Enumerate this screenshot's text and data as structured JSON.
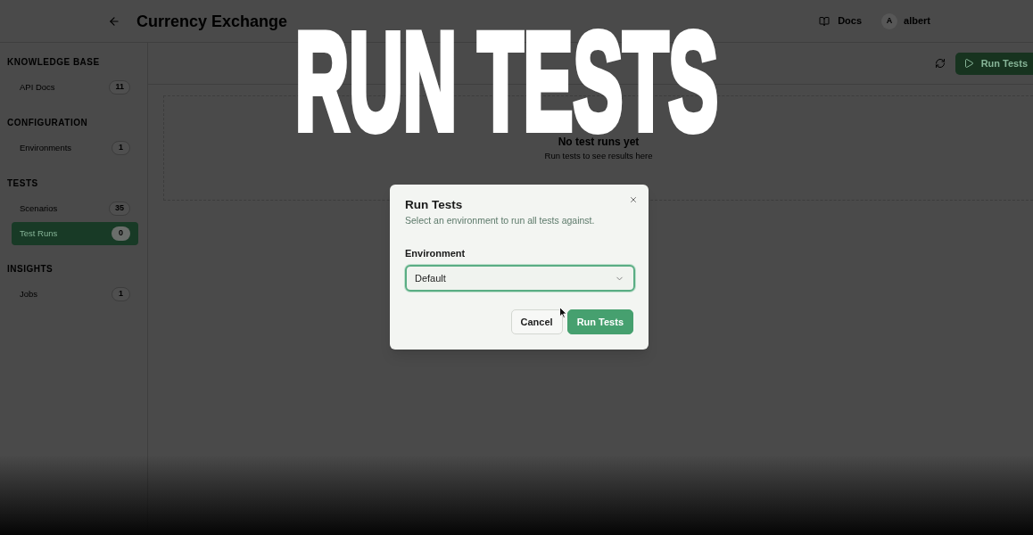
{
  "header": {
    "title": "Currency Exchange",
    "docs_link": "Docs",
    "user": {
      "initial": "A",
      "name": "albert"
    }
  },
  "sidebar": {
    "sections": [
      {
        "title": "KNOWLEDGE BASE",
        "items": [
          {
            "label": "API Docs",
            "count": "11",
            "selected": false
          }
        ]
      },
      {
        "title": "CONFIGURATION",
        "items": [
          {
            "label": "Environments",
            "count": "1",
            "selected": false
          }
        ]
      },
      {
        "title": "TESTS",
        "items": [
          {
            "label": "Scenarios",
            "count": "35",
            "selected": false
          },
          {
            "label": "Test Runs",
            "count": "0",
            "selected": true
          }
        ]
      },
      {
        "title": "INSIGHTS",
        "items": [
          {
            "label": "Jobs",
            "count": "1",
            "selected": false
          }
        ]
      }
    ]
  },
  "toolbar": {
    "run_button": "Run Tests"
  },
  "empty_state": {
    "title": "No test runs yet",
    "hint": "Run tests to see results here"
  },
  "dialog": {
    "title": "Run Tests",
    "description": "Select an environment to run all tests against.",
    "field": {
      "label": "Environment",
      "value": "Default",
      "focused": true
    },
    "buttons": [
      {
        "kind": "secondary",
        "label": "Cancel"
      },
      {
        "kind": "primary",
        "label": "Run Tests"
      }
    ]
  },
  "caption": "RUN TESTS"
}
